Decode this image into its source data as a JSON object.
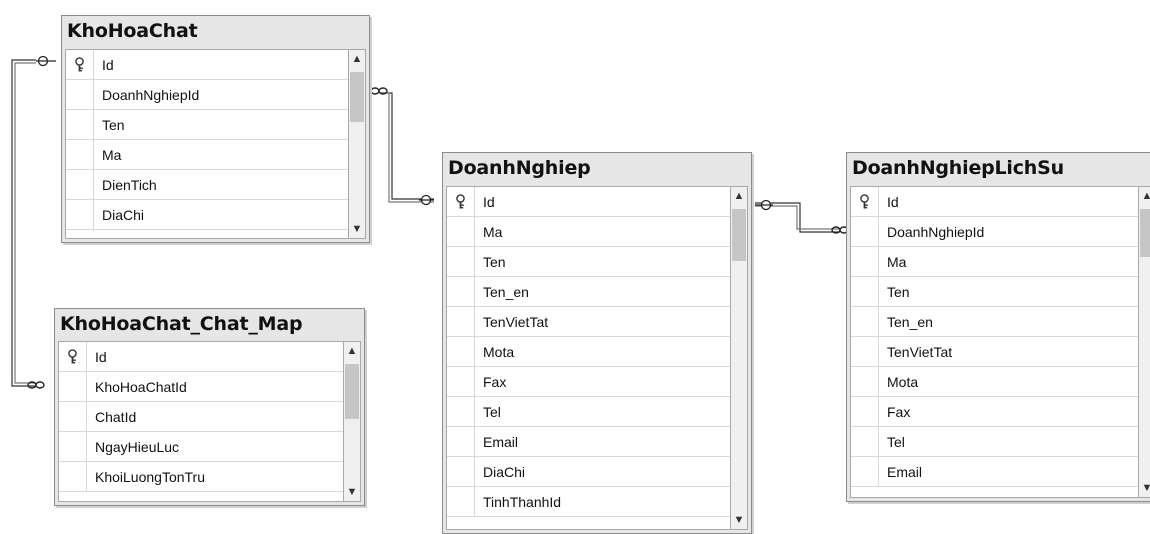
{
  "tables": {
    "khohoachat": {
      "title": "KhoHoaChat",
      "columns": [
        "Id",
        "DoanhNghiepId",
        "Ten",
        "Ma",
        "DienTich",
        "DiaChi"
      ]
    },
    "khohoachat_chat_map": {
      "title": "KhoHoaChat_Chat_Map",
      "columns": [
        "Id",
        "KhoHoaChatId",
        "ChatId",
        "NgayHieuLuc",
        "KhoiLuongTonTru"
      ]
    },
    "doanhnghiep": {
      "title": "DoanhNghiep",
      "columns": [
        "Id",
        "Ma",
        "Ten",
        "Ten_en",
        "TenVietTat",
        "Mota",
        "Fax",
        "Tel",
        "Email",
        "DiaChi",
        "TinhThanhId"
      ]
    },
    "doanhnghieplichsu": {
      "title": "DoanhNghiepLichSu",
      "columns": [
        "Id",
        "DoanhNghiepId",
        "Ma",
        "Ten",
        "Ten_en",
        "TenVietTat",
        "Mota",
        "Fax",
        "Tel",
        "Email"
      ]
    }
  },
  "relationships": [
    {
      "from": "khohoachat",
      "to": "doanhnghiep",
      "one_end": "doanhnghiep",
      "many_end": "khohoachat"
    },
    {
      "from": "khohoachat_chat_map",
      "to": "khohoachat",
      "one_end": "khohoachat",
      "many_end": "khohoachat_chat_map"
    },
    {
      "from": "doanhnghieplichsu",
      "to": "doanhnghiep",
      "one_end": "doanhnghiep",
      "many_end": "doanhnghieplichsu"
    }
  ],
  "icons": {
    "key": "primary-key-icon",
    "scroll_up": "chevron-up-icon",
    "scroll_down": "chevron-down-icon"
  }
}
